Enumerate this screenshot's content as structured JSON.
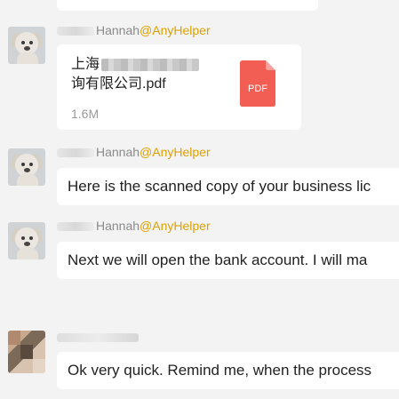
{
  "messages": [
    {
      "sender": {
        "handle": "Hannah",
        "tag": "@AnyHelper"
      },
      "file": {
        "name_prefix": "上海",
        "name_suffix": "询有限公司.pdf",
        "size": "1.6M",
        "icon_label": "PDF"
      }
    },
    {
      "sender": {
        "handle": "Hannah",
        "tag": "@AnyHelper"
      },
      "text": "Here is the scanned copy of your business lic"
    },
    {
      "sender": {
        "handle": "Hannah",
        "tag": "@AnyHelper"
      },
      "text": "Next we will open the bank account. I will ma"
    },
    {
      "text": "Ok very quick. Remind me, when the process"
    }
  ],
  "colors": {
    "background": "#f3f3f3",
    "bubble": "#ffffff",
    "tag": "#e0a100",
    "pdf_red": "#f25d54"
  }
}
